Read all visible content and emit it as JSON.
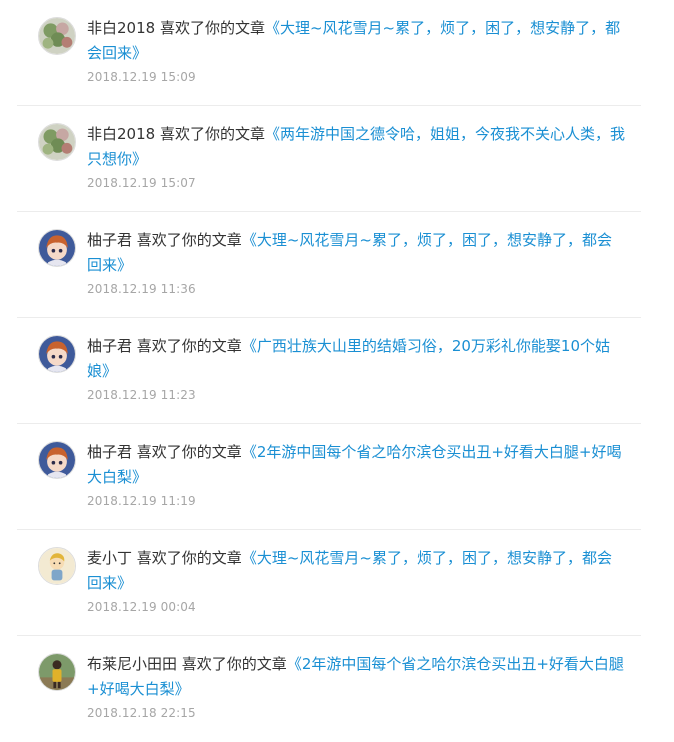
{
  "notifications": [
    {
      "user": "非白2018",
      "action": "喜欢了你的文章",
      "article": "《大理~风花雪月~累了，烦了，困了，想安静了，都会回来》",
      "time": "2018.12.19 15:09",
      "avatar": "plant"
    },
    {
      "user": "非白2018",
      "action": "喜欢了你的文章",
      "article": "《两年游中国之德令哈，姐姐，今夜我不关心人类，我只想你》",
      "time": "2018.12.19 15:07",
      "avatar": "plant"
    },
    {
      "user": "柚子君",
      "action": "喜欢了你的文章",
      "article": "《大理~风花雪月~累了，烦了，困了，想安静了，都会回来》",
      "time": "2018.12.19 11:36",
      "avatar": "anime"
    },
    {
      "user": "柚子君",
      "action": "喜欢了你的文章",
      "article": "《广西壮族大山里的结婚习俗，20万彩礼你能娶10个姑娘》",
      "time": "2018.12.19 11:23",
      "avatar": "anime"
    },
    {
      "user": "柚子君",
      "action": "喜欢了你的文章",
      "article": "《2年游中国每个省之哈尔滨仓买出丑+好看大白腿+好喝大白梨》",
      "time": "2018.12.19 11:19",
      "avatar": "anime"
    },
    {
      "user": "麦小丁",
      "action": "喜欢了你的文章",
      "article": "《大理~风花雪月~累了，烦了，困了，想安静了，都会回来》",
      "time": "2018.12.19 00:04",
      "avatar": "cartoon"
    },
    {
      "user": "布莱尼小田田",
      "action": "喜欢了你的文章",
      "article": "《2年游中国每个省之哈尔滨仓买出丑+好看大白腿+好喝大白梨》",
      "time": "2018.12.18 22:15",
      "avatar": "photo"
    }
  ]
}
